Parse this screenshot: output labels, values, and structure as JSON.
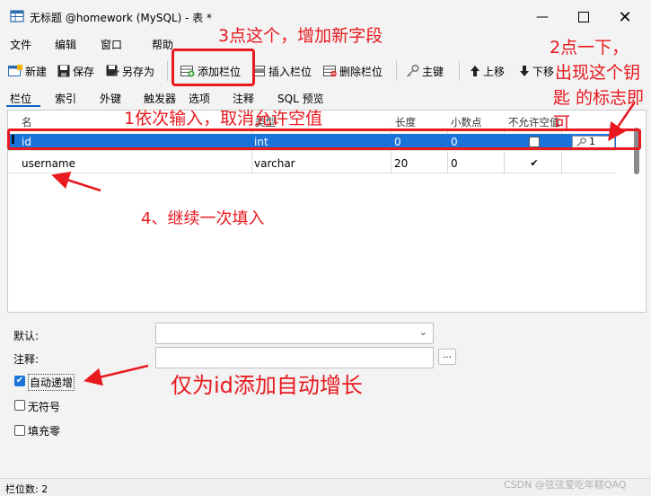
{
  "window": {
    "title": "无标题 @homework (MySQL) - 表 *"
  },
  "menu": [
    "文件",
    "编辑",
    "窗口",
    "帮助"
  ],
  "toolbar": {
    "new": "新建",
    "save": "保存",
    "save_as": "另存为",
    "add_field": "添加栏位",
    "insert_field": "插入栏位",
    "delete_field": "删除栏位",
    "primary_key": "主键",
    "move_up": "上移",
    "move_down": "下移"
  },
  "tabs": [
    "栏位",
    "索引",
    "外键",
    "触发器",
    "选项",
    "注释",
    "SQL 预览"
  ],
  "grid": {
    "headers": [
      "名",
      "类型",
      "长度",
      "小数点",
      "不允许空值",
      ""
    ],
    "rows": [
      {
        "name": "id",
        "type": "int",
        "length": "0",
        "decimals": "0",
        "not_null": false,
        "key": "1"
      },
      {
        "name": "username",
        "type": "varchar",
        "length": "20",
        "decimals": "0",
        "not_null": true,
        "key": ""
      }
    ]
  },
  "properties": {
    "default_label": "默认:",
    "comment_label": "注释:",
    "ellipsis": "...",
    "auto_increment_label": "自动递增",
    "auto_increment_checked": true,
    "unsigned_label": "无符号",
    "unsigned_checked": false,
    "zerofill_label": "填充零",
    "zerofill_checked": false
  },
  "status": {
    "field_count": "栏位数: 2"
  },
  "annotations": {
    "step1": "1依次输入，取消允许空值",
    "step2_line1": "2点一下，",
    "step2_line2": "出现这个钥",
    "step2_line3": "匙 的标志即",
    "step2_line4": "可",
    "step3": "3点这个，增加新字段",
    "step4": "4、继续一次填入",
    "auto_inc_note": "仅为id添加自动增长"
  },
  "watermark": "CSDN @弦弦爱吃年糕QAQ",
  "colors": {
    "selection": "#1a73d9",
    "annotation": "#e8191f"
  }
}
